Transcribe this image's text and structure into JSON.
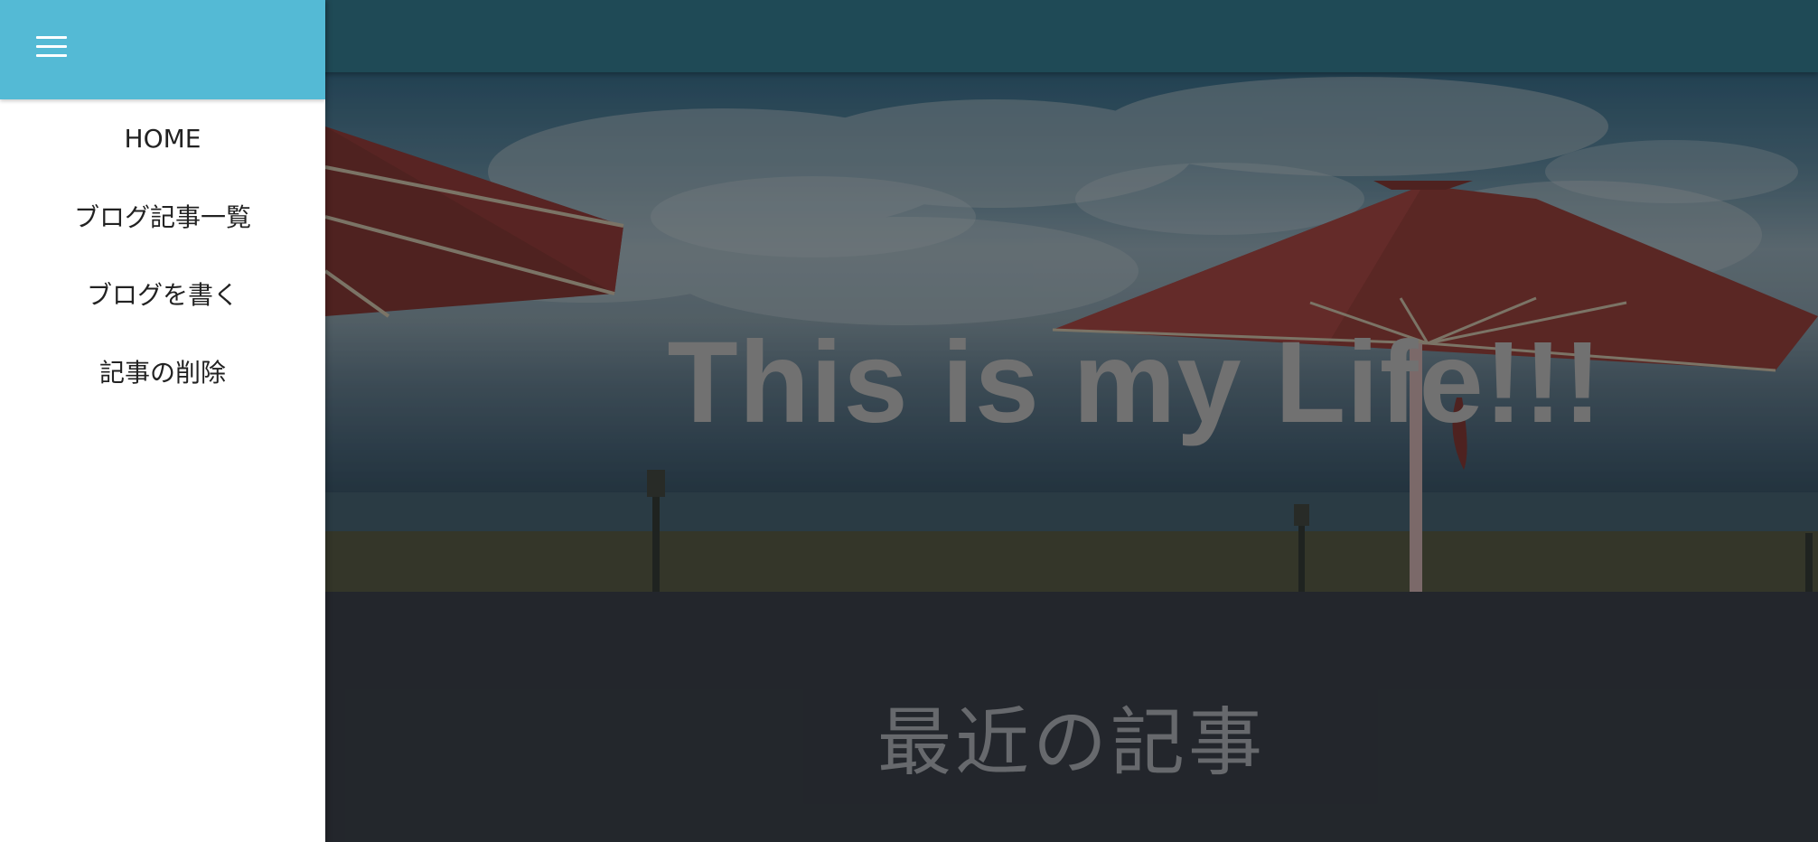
{
  "drawer": {
    "menu_icon": "hamburger-menu-icon",
    "header_color": "#54bad5",
    "items": [
      {
        "label": "HOME"
      },
      {
        "label": "ブログ記事一覧"
      },
      {
        "label": "ブログを書く"
      },
      {
        "label": "記事の削除"
      }
    ]
  },
  "header": {
    "bar_color": "#275b6a"
  },
  "hero": {
    "title": "This is my Life!!!",
    "image": "beach-umbrellas-photo"
  },
  "recent": {
    "title": "最近の記事"
  }
}
